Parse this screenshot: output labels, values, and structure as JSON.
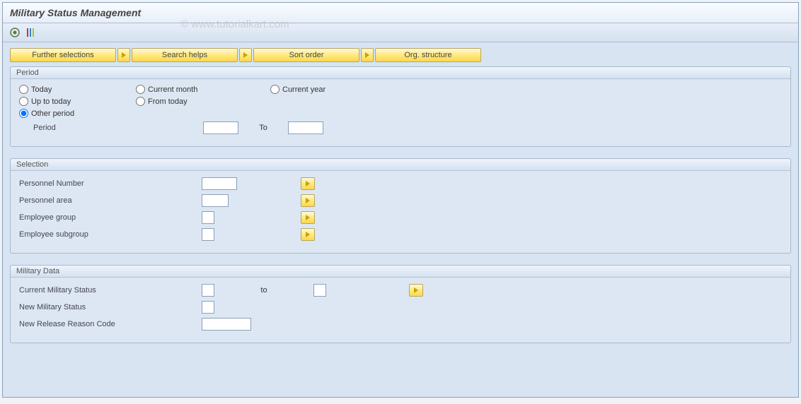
{
  "title": "Military Status Management",
  "watermark": "© www.tutorialkart.com",
  "toolbar_buttons": {
    "b1": "Further selections",
    "b2": "Search helps",
    "b3": "Sort order",
    "b4": "Org. structure"
  },
  "period": {
    "legend": "Period",
    "today": "Today",
    "current_month": "Current month",
    "current_year": "Current year",
    "up_to_today": "Up to today",
    "from_today": "From today",
    "other_period": "Other period",
    "period_lbl": "Period",
    "to_lbl": "To",
    "selected": "other_period",
    "period_from": "",
    "period_to": ""
  },
  "selection": {
    "legend": "Selection",
    "personnel_number_lbl": "Personnel Number",
    "personnel_number_val": "",
    "personnel_area_lbl": "Personnel area",
    "personnel_area_val": "",
    "employee_group_lbl": "Employee group",
    "employee_group_val": "",
    "employee_subgroup_lbl": "Employee subgroup",
    "employee_subgroup_val": ""
  },
  "military": {
    "legend": "Military Data",
    "current_status_lbl": "Current Military Status",
    "current_status_from": "",
    "to_lbl": "to",
    "current_status_to": "",
    "new_status_lbl": "New Military Status",
    "new_status_val": "",
    "new_reason_lbl": "New Release Reason Code",
    "new_reason_val": ""
  }
}
